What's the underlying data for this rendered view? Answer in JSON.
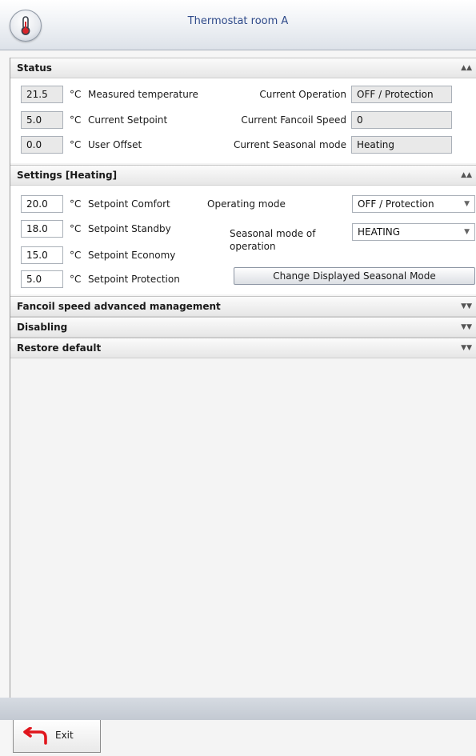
{
  "window": {
    "title": "Thermostat room A"
  },
  "status": {
    "header": "Status",
    "measured_temperature": {
      "value": "21.5",
      "unit": "°C",
      "label": "Measured temperature"
    },
    "current_setpoint": {
      "value": "5.0",
      "unit": "°C",
      "label": "Current Setpoint"
    },
    "user_offset": {
      "value": "0.0",
      "unit": "°C",
      "label": "User Offset"
    },
    "current_operation": {
      "label": "Current Operation",
      "value": "OFF / Protection"
    },
    "current_fancoil_speed": {
      "label": "Current Fancoil Speed",
      "value": "0"
    },
    "current_seasonal_mode": {
      "label": "Current Seasonal mode",
      "value": "Heating"
    }
  },
  "settings": {
    "header": "Settings [Heating]",
    "setpoint_comfort": {
      "value": "20.0",
      "unit": "°C",
      "label": "Setpoint Comfort"
    },
    "setpoint_standby": {
      "value": "18.0",
      "unit": "°C",
      "label": "Setpoint Standby"
    },
    "setpoint_economy": {
      "value": "15.0",
      "unit": "°C",
      "label": "Setpoint Economy"
    },
    "setpoint_protection": {
      "value": "5.0",
      "unit": "°C",
      "label": "Setpoint Protection"
    },
    "operating_mode": {
      "label": "Operating mode",
      "value": "OFF / Protection"
    },
    "seasonal_mode": {
      "label_line1": "Seasonal mode of",
      "label_line2": "operation",
      "value": "HEATING"
    },
    "change_button": "Change Displayed Seasonal Mode"
  },
  "collapsed_sections": [
    "Fancoil speed advanced management",
    "Disabling",
    "Restore default"
  ],
  "footer": {
    "exit_label": "Exit"
  },
  "icons": {
    "title": "thermometer-icon",
    "expanded": "chevron-double-up-icon",
    "collapsed": "chevron-double-down-icon",
    "dropdown": "dropdown-arrow-icon",
    "exit": "exit-arrow-icon"
  },
  "colors": {
    "title_text": "#2f4a8a",
    "exit_icon": "#e0161d"
  }
}
